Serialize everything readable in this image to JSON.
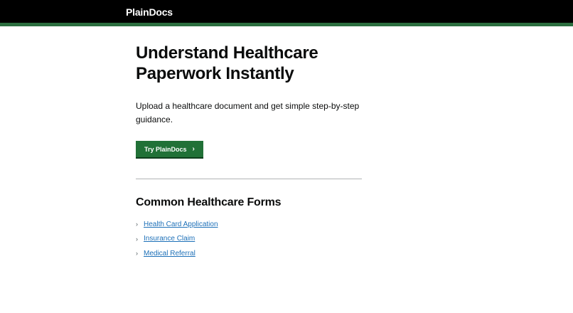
{
  "header": {
    "brand": "PlainDocs"
  },
  "hero": {
    "title": "Understand Healthcare Paperwork Instantly",
    "intro": "Upload a healthcare document and get simple step-by-step guidance.",
    "cta_label": "Try PlainDocs",
    "cta_icon": "chevron-right-icon"
  },
  "forms": {
    "heading": "Common Healthcare Forms",
    "items": [
      {
        "label": "Health Card Application",
        "icon": "chevron-right-icon"
      },
      {
        "label": "Insurance Claim",
        "icon": "chevron-right-icon"
      },
      {
        "label": "Medical Referral",
        "icon": "chevron-right-icon"
      }
    ]
  },
  "colors": {
    "header_bg": "#000000",
    "header_accent": "#2b6e3f",
    "button_bg": "#217137",
    "link": "#1d70b8"
  }
}
